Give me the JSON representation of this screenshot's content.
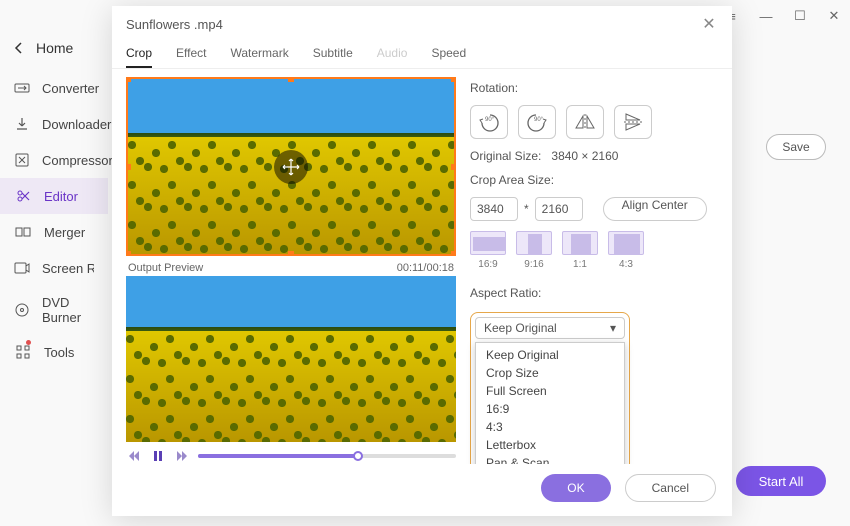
{
  "window": {
    "file_title": "Sunflowers .mp4"
  },
  "sidebar": {
    "home": "Home",
    "items": [
      {
        "label": "Converter"
      },
      {
        "label": "Downloader"
      },
      {
        "label": "Compressor"
      },
      {
        "label": "Editor"
      },
      {
        "label": "Merger"
      },
      {
        "label": "Screen Recorder"
      },
      {
        "label": "DVD Burner"
      },
      {
        "label": "Tools"
      }
    ]
  },
  "background": {
    "save": "Save",
    "start_all": "Start All"
  },
  "modal": {
    "tabs": {
      "crop": "Crop",
      "effect": "Effect",
      "watermark": "Watermark",
      "subtitle": "Subtitle",
      "audio": "Audio",
      "speed": "Speed"
    },
    "output_preview": "Output Preview",
    "timecode": "00:11/00:18",
    "rotation_label": "Rotation:",
    "rotate_left": "90°",
    "rotate_right": "90°",
    "original_size_label": "Original Size:",
    "original_size_value": "3840 × 2160",
    "crop_area_label": "Crop Area Size:",
    "crop_w": "3840",
    "crop_star": "*",
    "crop_h": "2160",
    "align_center": "Align Center",
    "ratios": {
      "r169": "16:9",
      "r916": "9:16",
      "r11": "1:1",
      "r43": "4:3"
    },
    "aspect_label": "Aspect Ratio:",
    "aspect_selected": "Keep Original",
    "aspect_options": [
      "Keep Original",
      "Crop Size",
      "Full Screen",
      "16:9",
      "4:3",
      "Letterbox",
      "Pan & Scan"
    ],
    "ok": "OK",
    "cancel": "Cancel"
  }
}
